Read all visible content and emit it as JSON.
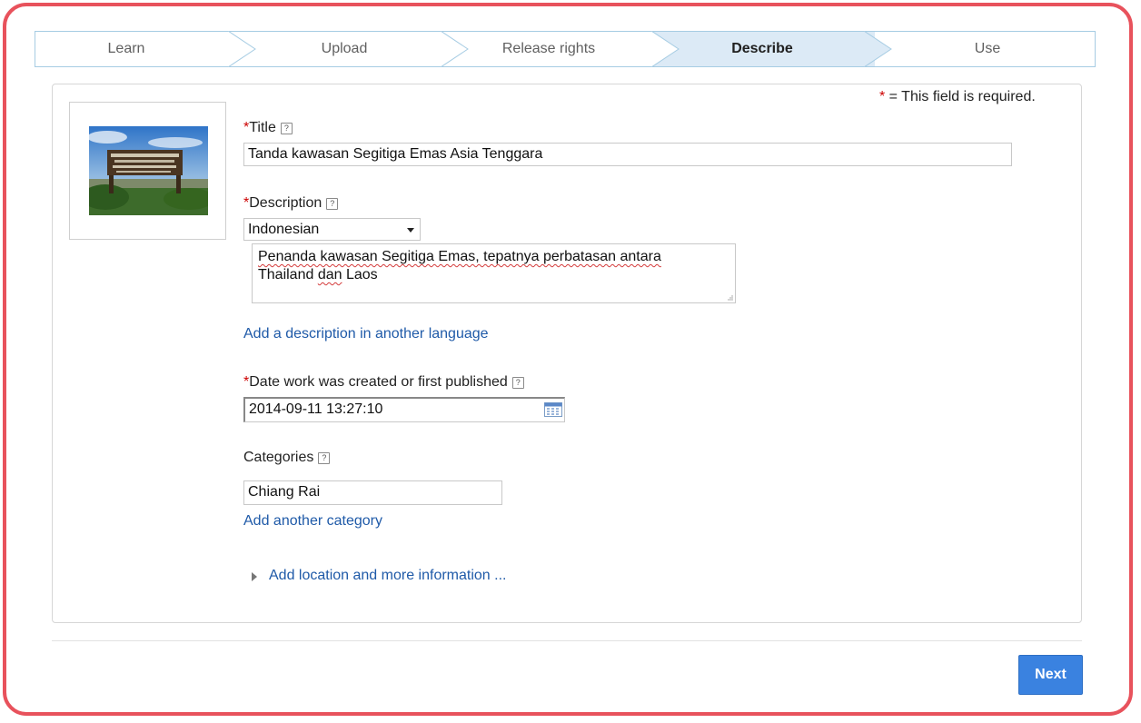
{
  "steps": [
    {
      "label": "Learn",
      "active": false
    },
    {
      "label": "Upload",
      "active": false
    },
    {
      "label": "Release rights",
      "active": false
    },
    {
      "label": "Describe",
      "active": true
    },
    {
      "label": "Use",
      "active": false
    }
  ],
  "required_note": {
    "star": "*",
    "text": " = This field is required."
  },
  "title_field": {
    "star": "*",
    "label": "Title",
    "help": "?",
    "value": "Tanda kawasan Segitiga Emas Asia Tenggara"
  },
  "description_field": {
    "star": "*",
    "label": "Description",
    "help": "?",
    "language": "Indonesian",
    "text_line1_a": "Penanda kawasan Segitiga Emas, tepatnya perbatasan antara",
    "text_line2_a": "Thailand",
    "text_line2_b": "dan",
    "text_line2_c": "Laos",
    "add_language_link": "Add a description in another language"
  },
  "date_field": {
    "star": "*",
    "label": "Date work was created or first published",
    "help": "?",
    "value": "2014-09-11 13:27:10",
    "icon": "calendar-icon"
  },
  "categories_field": {
    "label": "Categories",
    "help": "?",
    "value": "Chiang Rai",
    "add_link": "Add another category"
  },
  "more_info": {
    "icon": "triangle-right-icon",
    "link": "Add location and more information ..."
  },
  "next_button": {
    "label": "Next",
    "color": "#3a82e0"
  },
  "colors": {
    "frame": "#e8525c",
    "active_step": "#dceaf6",
    "link": "#1f5aa8",
    "required_star": "#cc0000"
  }
}
